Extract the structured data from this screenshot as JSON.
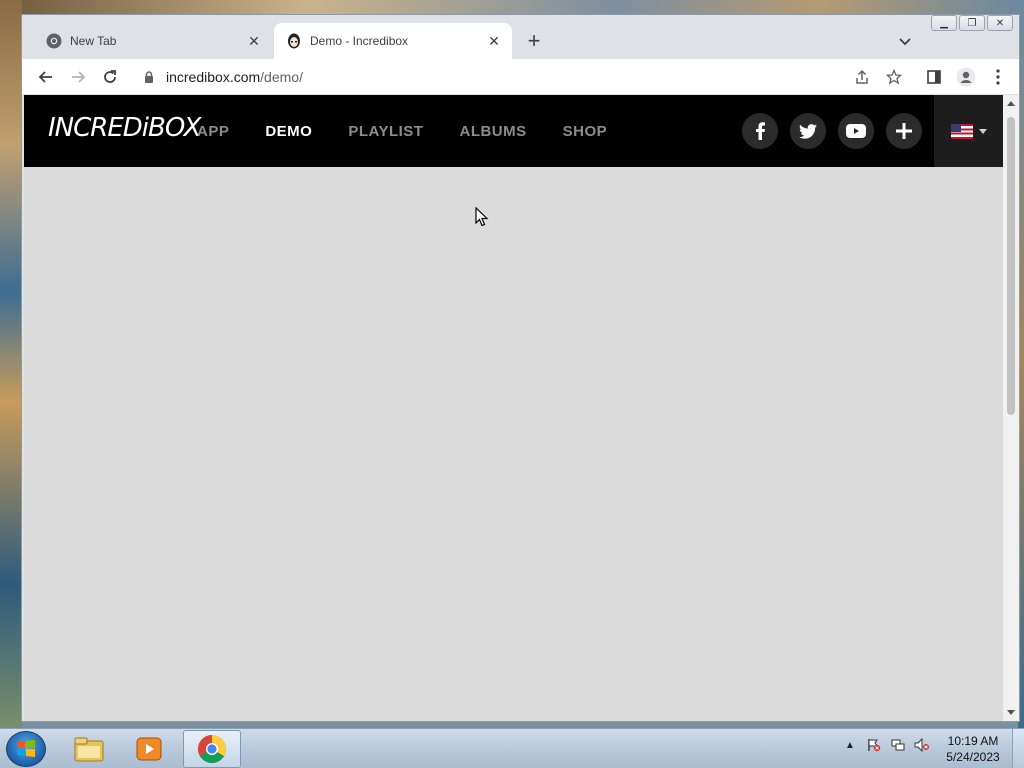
{
  "browser": {
    "tabs": [
      {
        "title": "New Tab",
        "icon": "chrome-icon",
        "active": false
      },
      {
        "title": "Demo - Incredibox",
        "icon": "incredibox-favicon",
        "active": true
      }
    ],
    "new_tab_icon": "plus-icon",
    "tab_search_icon": "chevron-down-icon",
    "window_buttons": [
      "minimize",
      "maximize",
      "close"
    ],
    "toolbar": {
      "back_icon": "back-arrow-icon",
      "forward_icon": "forward-arrow-icon",
      "reload_icon": "reload-icon",
      "url_host": "incredibox.com",
      "url_path": "/demo/",
      "share_icon": "share-icon",
      "bookmark_icon": "star-icon",
      "side_panel_icon": "side-panel-icon",
      "profile_icon": "profile-icon",
      "menu_icon": "kebab-menu-icon"
    }
  },
  "site": {
    "logo": "INCREDiBOX",
    "nav": [
      {
        "label": "APP",
        "active": false
      },
      {
        "label": "DEMO",
        "active": true
      },
      {
        "label": "PLAYLIST",
        "active": false
      },
      {
        "label": "ALBUMS",
        "active": false
      },
      {
        "label": "SHOP",
        "active": false
      }
    ],
    "socials": [
      "facebook-icon",
      "twitter-icon",
      "youtube-icon",
      "plus-icon"
    ],
    "language": "us-flag-icon",
    "colors": {
      "nav_bg": "#000000",
      "nav_inactive": "#8c8c8c",
      "nav_active": "#ffffff",
      "page_bg": "#dbdbdb"
    }
  },
  "taskbar": {
    "pinned": [
      "windows-explorer-icon",
      "media-player-icon",
      "chrome-icon"
    ],
    "active_app": "chrome",
    "clock_time": "10:19 AM",
    "clock_date": "5/24/2023",
    "tray_icons": [
      "show-hidden-icons-arrow",
      "action-center-flag-icon",
      "network-icon",
      "volume-muted-icon"
    ]
  }
}
